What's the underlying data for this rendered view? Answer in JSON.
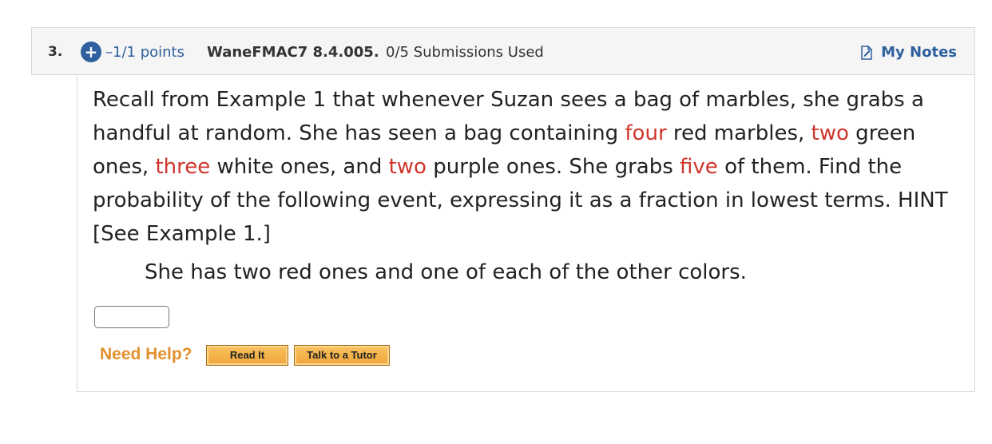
{
  "question": {
    "number": "3.",
    "points": "–1/1 points",
    "assignment_id": "WaneFMAC7 8.4.005.",
    "submissions": "0/5 Submissions Used",
    "my_notes_label": "My Notes",
    "icons": [
      "plus-icon",
      "note-icon"
    ],
    "accent_color": "#2e5f9e",
    "highlight_color": "#d0352b"
  },
  "body": {
    "text_1": "Recall from Example 1 that whenever Suzan sees a bag of marbles, she grabs a handful at random. She has seen a bag containing ",
    "red_count": "four",
    "text_2": " red marbles, ",
    "green_count": "two",
    "text_3": " green ones, ",
    "white_count": "three",
    "text_4": " white ones, and ",
    "purple_count": "two",
    "text_5": " purple ones. She grabs ",
    "grab_count": "five",
    "text_6": " of them. Find the probability of the following event, expressing it as a fraction in lowest terms. HINT [See Example 1.]",
    "event": "She has two red ones and one of each of the other colors.",
    "answer_value": ""
  },
  "help": {
    "label": "Need Help?",
    "read_it": "Read It",
    "talk_to_tutor": "Talk to a Tutor"
  }
}
